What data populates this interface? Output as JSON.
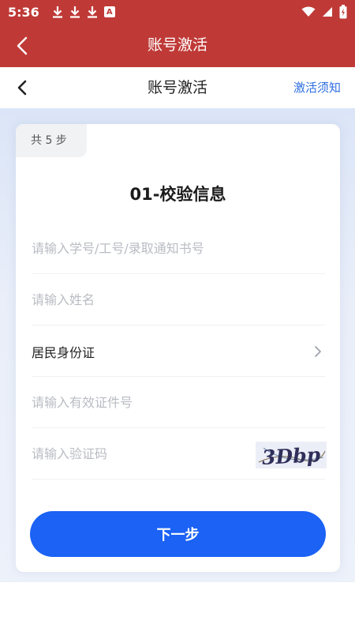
{
  "status_bar": {
    "time": "5:36",
    "notification_icons": [
      "download-icon",
      "download-icon",
      "download-icon",
      "a-icon"
    ],
    "a_icon_text": "A",
    "system_icons": [
      "wifi-icon",
      "signal-icon",
      "battery-icon"
    ]
  },
  "app_bar": {
    "title": "账号激活",
    "background": "#bf3a37"
  },
  "nav": {
    "title": "账号激活",
    "link": "激活须知",
    "link_color": "#2f6fe0"
  },
  "card": {
    "step_badge": "共 5 步",
    "title": "01-校验信息",
    "fields": {
      "student_id": {
        "placeholder": "请输入学号/工号/录取通知书号",
        "value": ""
      },
      "name": {
        "placeholder": "请输入姓名",
        "value": ""
      },
      "id_type": {
        "value": "居民身份证"
      },
      "id_number": {
        "placeholder": "请输入有效证件号",
        "value": ""
      },
      "captcha": {
        "placeholder": "请输入验证码",
        "value": "",
        "image_text": "3Dbp"
      }
    },
    "next_button": "下一步",
    "accent": "#1b62f5"
  }
}
